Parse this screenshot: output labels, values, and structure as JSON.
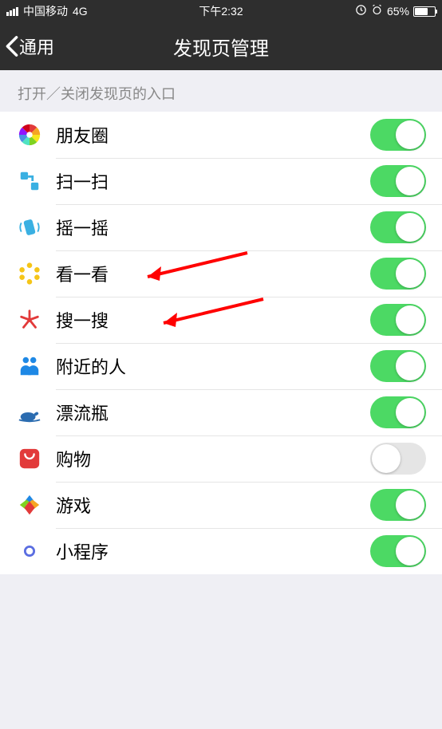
{
  "status": {
    "carrier": "中国移动",
    "network": "4G",
    "time": "下午2:32",
    "battery_pct": "65%"
  },
  "nav": {
    "back_label": "通用",
    "title": "发现页管理"
  },
  "section": {
    "hint": "打开／关闭发现页的入口"
  },
  "rows": [
    {
      "label": "朋友圈",
      "on": true,
      "icon": "moments"
    },
    {
      "label": "扫一扫",
      "on": true,
      "icon": "scan"
    },
    {
      "label": "摇一摇",
      "on": true,
      "icon": "shake"
    },
    {
      "label": "看一看",
      "on": true,
      "icon": "look"
    },
    {
      "label": "搜一搜",
      "on": true,
      "icon": "search"
    },
    {
      "label": "附近的人",
      "on": true,
      "icon": "nearby"
    },
    {
      "label": "漂流瓶",
      "on": true,
      "icon": "bottle"
    },
    {
      "label": "购物",
      "on": false,
      "icon": "shopping"
    },
    {
      "label": "游戏",
      "on": true,
      "icon": "games"
    },
    {
      "label": "小程序",
      "on": true,
      "icon": "miniprogram"
    }
  ],
  "annotations": {
    "arrow_targets": [
      "看一看",
      "搜一搜"
    ]
  }
}
